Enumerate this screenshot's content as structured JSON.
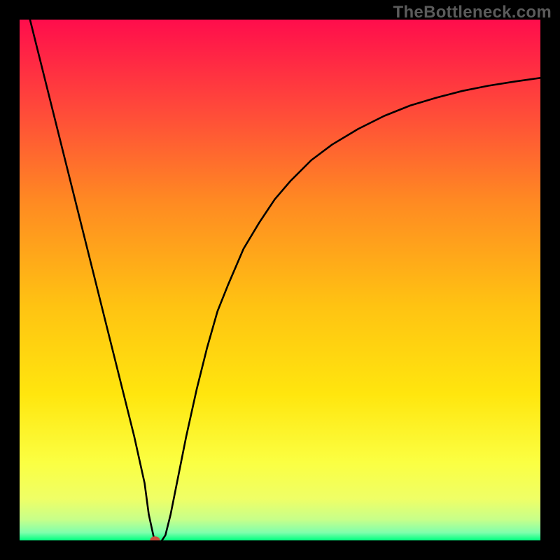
{
  "watermark": "TheBottleneck.com",
  "chart_data": {
    "type": "line",
    "title": "",
    "xlabel": "",
    "ylabel": "",
    "xlim": [
      0,
      100
    ],
    "ylim": [
      0,
      100
    ],
    "grid": false,
    "legend": false,
    "background_gradient": {
      "top": "#ff0d4c",
      "upper_mid": "#ff6e2d",
      "mid": "#ffb915",
      "lower_mid": "#ffe60e",
      "lower": "#fbff42",
      "bottom_band": "#e6ff7d",
      "bottom": "#00ff80"
    },
    "series": [
      {
        "name": "bottleneck-curve",
        "color": "#000000",
        "x": [
          0,
          2,
          4,
          6,
          8,
          10,
          12,
          14,
          16,
          18,
          20,
          22,
          24,
          24.8,
          26,
          27,
          28,
          29,
          30,
          32,
          34,
          36,
          38,
          40,
          43,
          46,
          49,
          52,
          56,
          60,
          65,
          70,
          75,
          80,
          85,
          90,
          95,
          100
        ],
        "y": [
          108,
          100,
          92,
          84,
          76,
          68,
          60,
          52,
          44,
          36,
          28,
          20,
          11,
          5,
          -0.5,
          -0.5,
          1,
          5,
          10,
          20,
          29,
          37,
          44,
          49,
          56,
          61,
          65.5,
          69,
          73,
          76,
          79,
          81.5,
          83.5,
          85,
          86.3,
          87.3,
          88.1,
          88.8
        ]
      }
    ],
    "marker": {
      "name": "optimal-point",
      "x": 26,
      "y": 0.1,
      "color": "#cf4d3c",
      "rx": 7,
      "ry": 5
    }
  }
}
